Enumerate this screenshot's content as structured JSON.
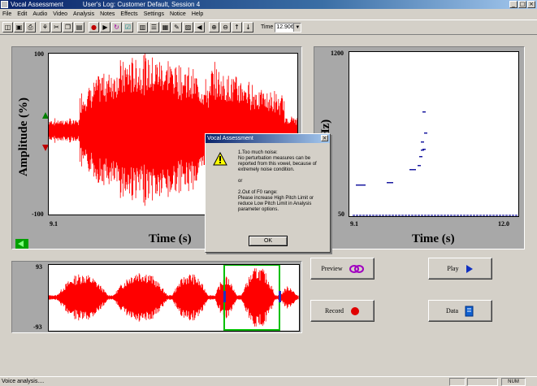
{
  "window": {
    "title": "Vocal Assessment",
    "subtitle": "User's Log: Customer Default, Session 4"
  },
  "menu": [
    "File",
    "Edit",
    "Audio",
    "Video",
    "Analysis",
    "Notes",
    "Effects",
    "Settings",
    "Notice",
    "Help"
  ],
  "toolbar": {
    "time_label": "Time",
    "time_value": "12.906"
  },
  "amplitude_panel": {
    "y_max": "100",
    "y_min": "-100",
    "x_start": "9.1",
    "y_axis_title": "Amplitude (%)",
    "x_axis_title": "Time (s)"
  },
  "pitch_panel": {
    "y_max": "1200",
    "y_min": "50",
    "x_start": "9.1",
    "x_end": "12.0",
    "y_axis_title_partial": "Hz)",
    "x_axis_title": "Time (s)"
  },
  "overview_panel": {
    "y_max": "93",
    "y_min": "-93"
  },
  "dialog": {
    "title": "Vocal Assessment",
    "lines": [
      "1.Too much noise:",
      "No perturbation measures can be reported from this vowel, because of extremely noise condition.",
      "or",
      "2.Out of F0 range:",
      "Please increase High Pitch Limit or reduce Low Pitch Limit in Analysis parameter options."
    ],
    "ok_label": "OK"
  },
  "buttons": {
    "preview": "Preview",
    "play": "Play",
    "record": "Record",
    "data": "Data"
  },
  "status": {
    "text": "Voice analysis....",
    "num": "NUM"
  },
  "colors": {
    "waveform": "#ff0000",
    "selection": "#00c000",
    "pitch_points": "#1a1aa0"
  }
}
